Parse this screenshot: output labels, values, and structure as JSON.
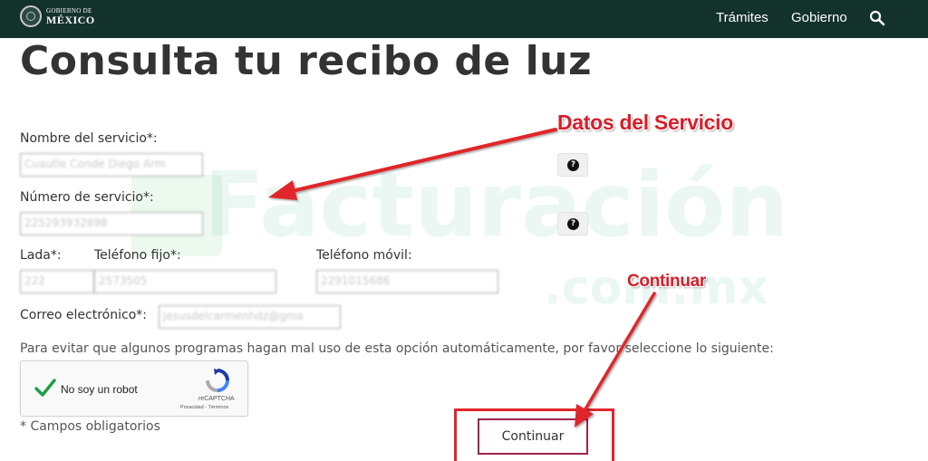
{
  "header": {
    "logo_small": "GOBIERNO DE",
    "logo_big": "MÉXICO",
    "nav": [
      "Trámites",
      "Gobierno"
    ],
    "search_icon": "search-icon",
    "background": "#13322b"
  },
  "page": {
    "title": "Consulta tu recibo de luz"
  },
  "watermark": {
    "text": "Facturación",
    "sub": ".com.mx"
  },
  "form": {
    "nombre_label": "Nombre del servicio*:",
    "nombre_value": "Cuautle Conde Diego Arm",
    "numero_label": "Número de servicio*:",
    "numero_value": "225293932898",
    "lada_label": "Lada*:",
    "lada_value": "222",
    "telefono_fijo_label": "Teléfono fijo*:",
    "telefono_fijo_value": "2573505",
    "telefono_movil_label": "Teléfono móvil:",
    "telefono_movil_value": "2291015686",
    "correo_label": "Correo electrónico*:",
    "correo_value": "jesusdelcarmenhdz@gma",
    "help_glyph": "?",
    "captcha_prompt": "Para evitar que algunos programas hagan mal uso de esta opción automáticamente, por favor seleccione lo siguiente:",
    "captcha": {
      "label": "No soy un robot",
      "brand": "reCAPTCHA",
      "links": "Privacidad - Términos",
      "checked": true
    },
    "required_note": "* Campos obligatorios",
    "continue_button": "Continuar"
  },
  "annotations": {
    "datos_servicio": "Datos del Servicio",
    "continuar": "Continuar",
    "color": "#d41f2a"
  }
}
